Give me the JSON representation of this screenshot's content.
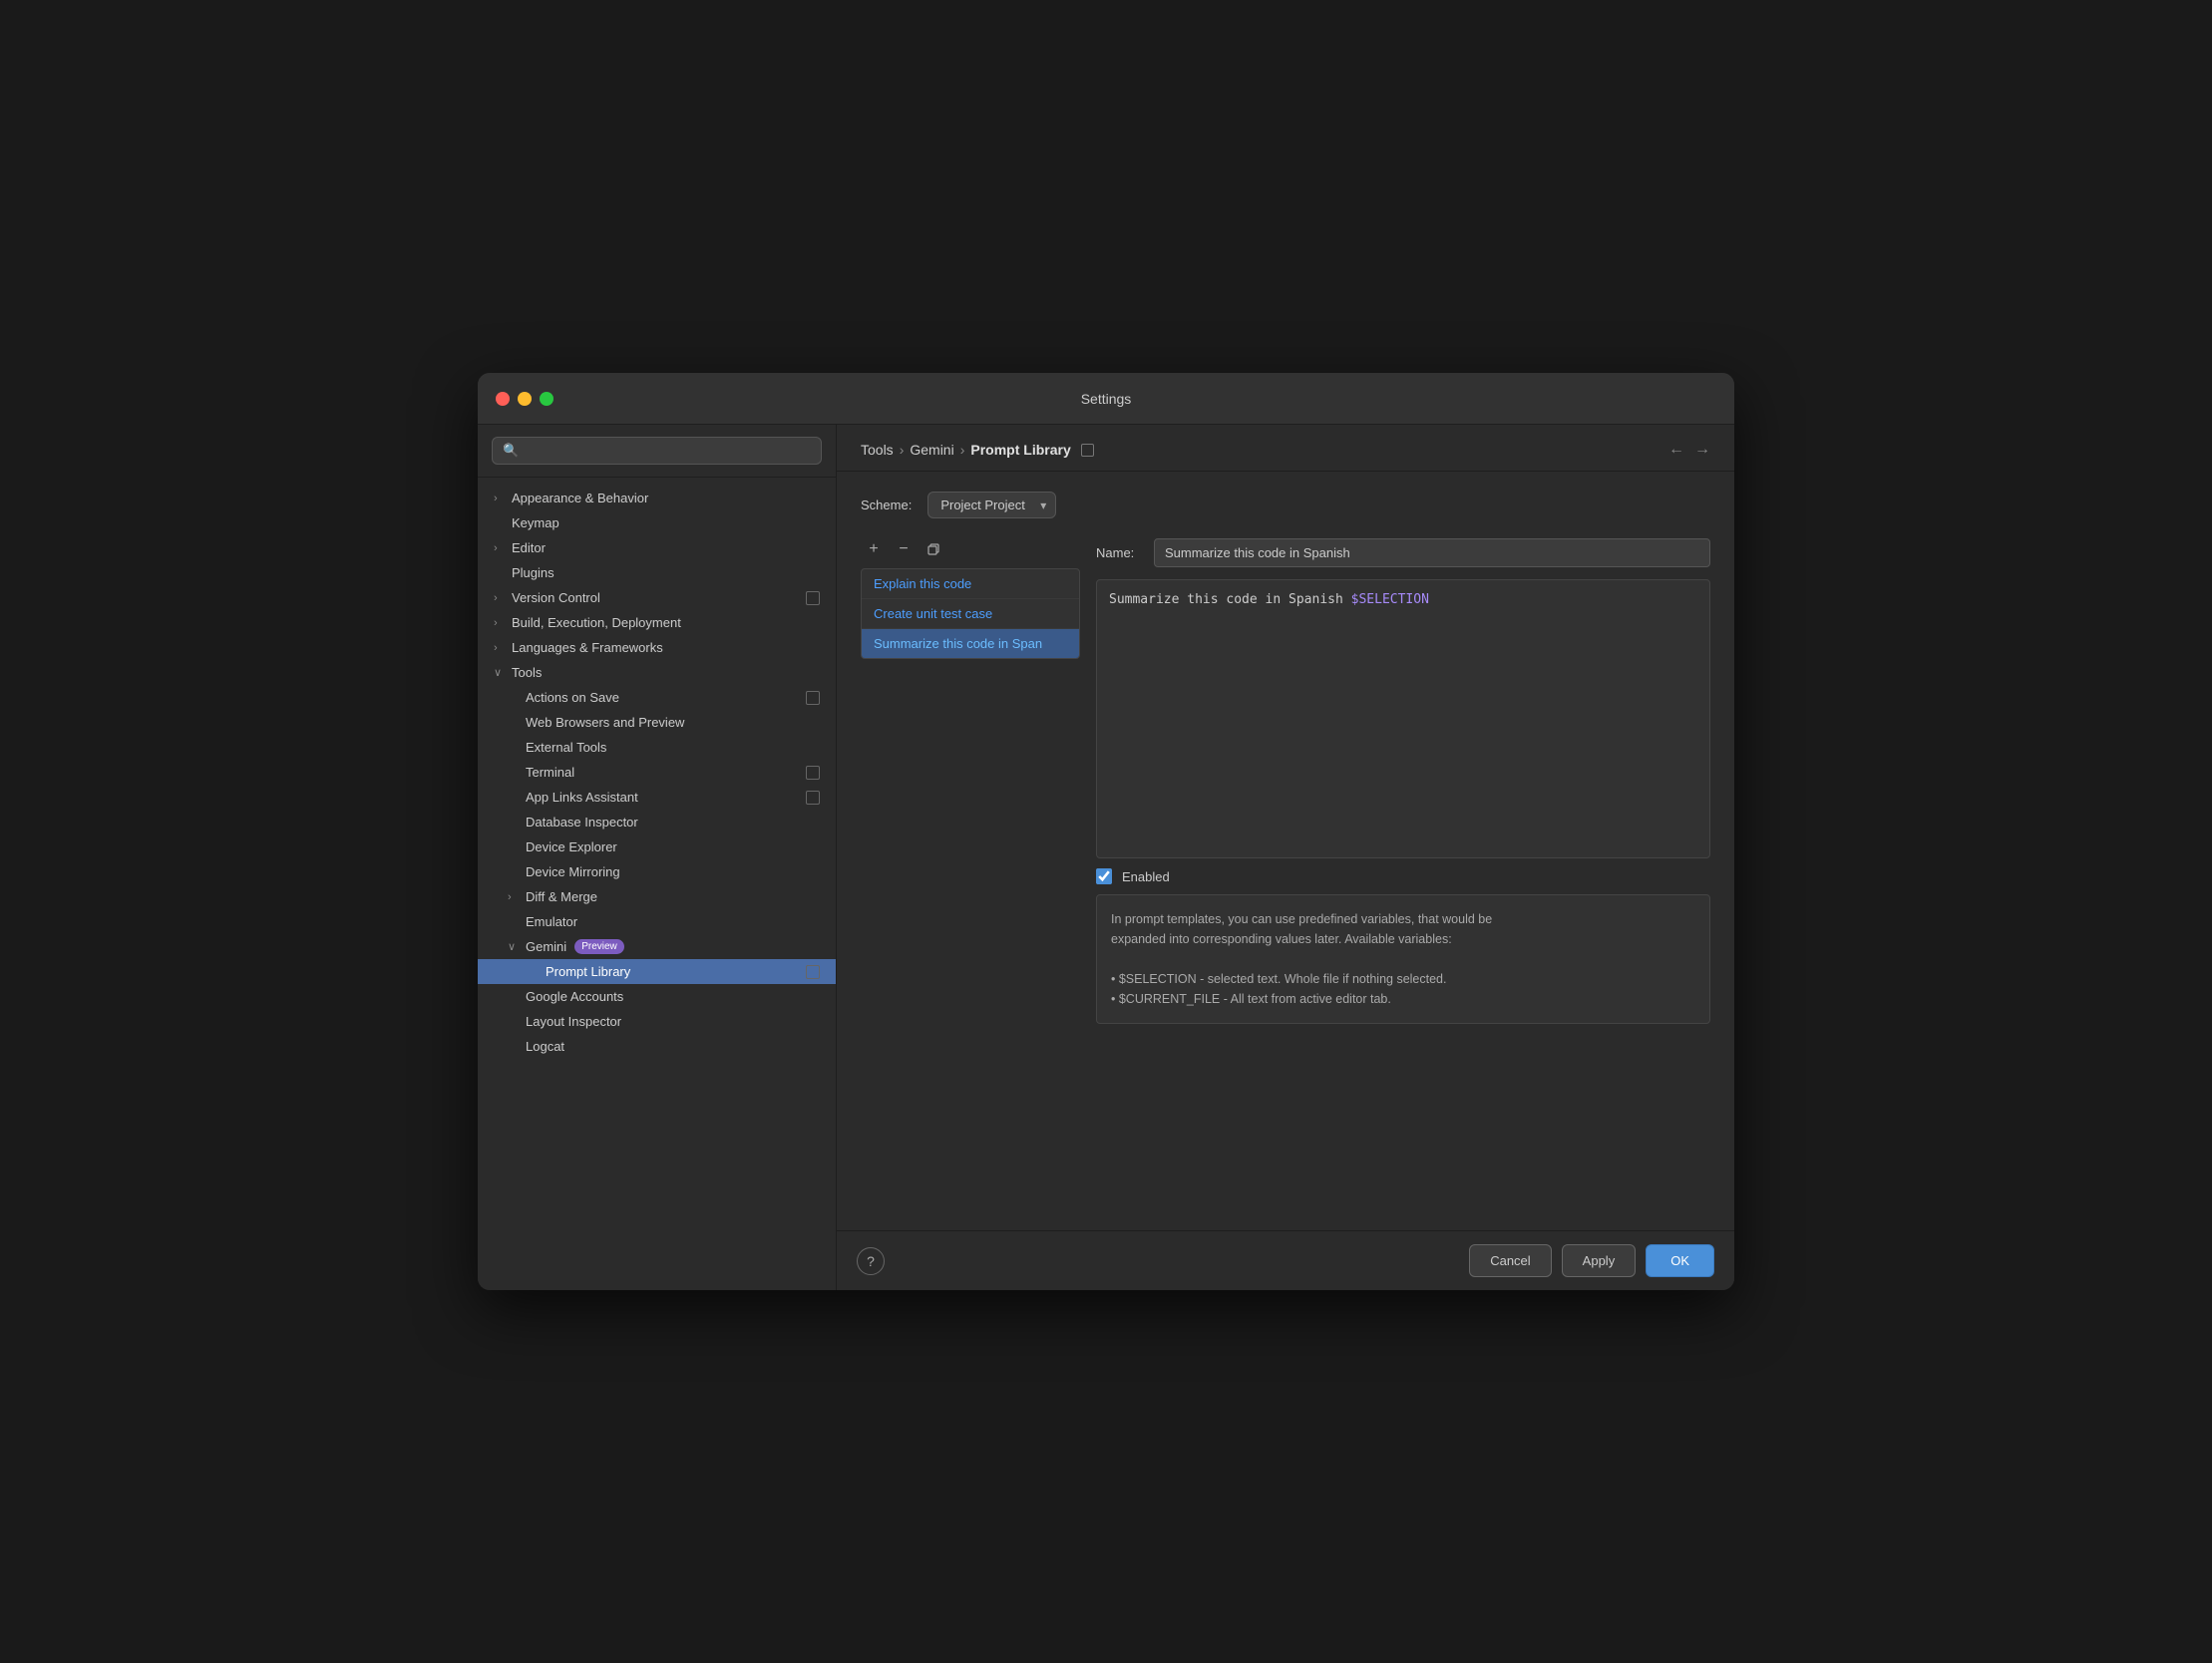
{
  "window": {
    "title": "Settings"
  },
  "sidebar": {
    "search_placeholder": "🔍",
    "items": [
      {
        "id": "appearance",
        "label": "Appearance & Behavior",
        "indent": 0,
        "chevron": "›",
        "collapsed": true
      },
      {
        "id": "keymap",
        "label": "Keymap",
        "indent": 0,
        "chevron": ""
      },
      {
        "id": "editor",
        "label": "Editor",
        "indent": 0,
        "chevron": "›",
        "collapsed": true
      },
      {
        "id": "plugins",
        "label": "Plugins",
        "indent": 0,
        "chevron": ""
      },
      {
        "id": "version-control",
        "label": "Version Control",
        "indent": 0,
        "chevron": "›",
        "collapsed": true,
        "indicator": true
      },
      {
        "id": "build",
        "label": "Build, Execution, Deployment",
        "indent": 0,
        "chevron": "›",
        "collapsed": true
      },
      {
        "id": "languages",
        "label": "Languages & Frameworks",
        "indent": 0,
        "chevron": "›",
        "collapsed": true
      },
      {
        "id": "tools",
        "label": "Tools",
        "indent": 0,
        "chevron": "∨",
        "expanded": true
      },
      {
        "id": "actions-on-save",
        "label": "Actions on Save",
        "indent": 1,
        "indicator": true
      },
      {
        "id": "web-browsers",
        "label": "Web Browsers and Preview",
        "indent": 1
      },
      {
        "id": "external-tools",
        "label": "External Tools",
        "indent": 1
      },
      {
        "id": "terminal",
        "label": "Terminal",
        "indent": 1,
        "indicator": true
      },
      {
        "id": "app-links",
        "label": "App Links Assistant",
        "indent": 1,
        "indicator": true
      },
      {
        "id": "database-inspector",
        "label": "Database Inspector",
        "indent": 1
      },
      {
        "id": "device-explorer",
        "label": "Device Explorer",
        "indent": 1
      },
      {
        "id": "device-mirroring",
        "label": "Device Mirroring",
        "indent": 1
      },
      {
        "id": "diff-merge",
        "label": "Diff & Merge",
        "indent": 1,
        "chevron": "›",
        "collapsed": true
      },
      {
        "id": "emulator",
        "label": "Emulator",
        "indent": 1
      },
      {
        "id": "gemini",
        "label": "Gemini",
        "indent": 1,
        "chevron": "∨",
        "expanded": true,
        "badge": "Preview"
      },
      {
        "id": "prompt-library",
        "label": "Prompt Library",
        "indent": 2,
        "active": true,
        "indicator": true
      },
      {
        "id": "google-accounts",
        "label": "Google Accounts",
        "indent": 1
      },
      {
        "id": "layout-inspector",
        "label": "Layout Inspector",
        "indent": 1
      },
      {
        "id": "logcat",
        "label": "Logcat",
        "indent": 1
      }
    ]
  },
  "breadcrumb": {
    "parts": [
      "Tools",
      "Gemini",
      "Prompt Library"
    ],
    "indicator": true
  },
  "scheme": {
    "label": "Scheme:",
    "value": "Project",
    "hint": "Project"
  },
  "prompt_list": {
    "items": [
      {
        "id": "explain",
        "label": "Explain this code",
        "active": false
      },
      {
        "id": "unit-test",
        "label": "Create unit test case",
        "active": false
      },
      {
        "id": "summarize",
        "label": "Summarize this code in Span",
        "active": true
      }
    ]
  },
  "editor": {
    "name_label": "Name:",
    "name_value": "Summarize this code in Spanish",
    "prompt_text": "Summarize this code in Spanish ",
    "prompt_variable": "$SELECTION",
    "enabled": true,
    "enabled_label": "Enabled"
  },
  "info_box": {
    "lines": [
      "In prompt templates, you can use predefined variables, that would be",
      "expanded into corresponding values later. Available variables:",
      "",
      "• $SELECTION - selected text. Whole file if nothing selected.",
      "• $CURRENT_FILE - All text from active editor tab."
    ]
  },
  "toolbar": {
    "add_label": "+",
    "remove_label": "−",
    "copy_label": "⊞"
  },
  "bottom_bar": {
    "help_label": "?",
    "cancel_label": "Cancel",
    "apply_label": "Apply",
    "ok_label": "OK"
  }
}
